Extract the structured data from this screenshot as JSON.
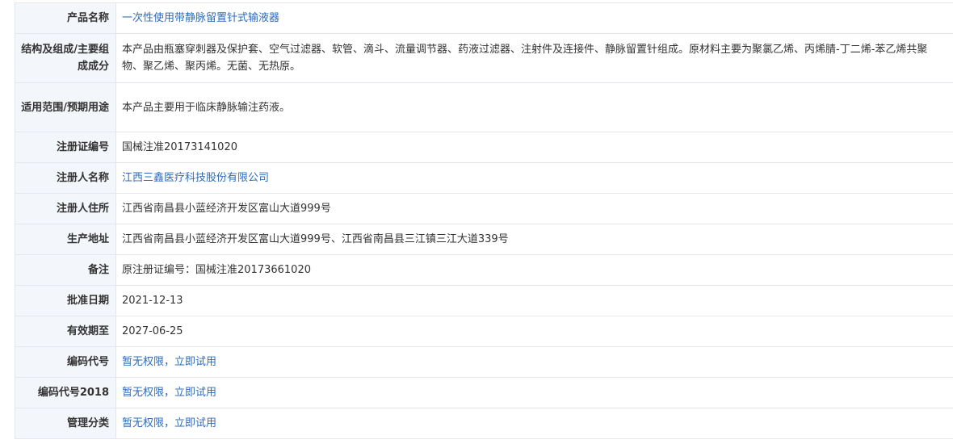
{
  "rows": [
    {
      "label": "产品名称",
      "value": "一次性使用带静脉留置针式输液器",
      "link": true
    },
    {
      "label": "结构及组成/主要组成成分",
      "value": "本产品由瓶塞穿刺器及保护套、空气过滤器、软管、滴斗、流量调节器、药液过滤器、注射件及连接件、静脉留置针组成。原材料主要为聚氯乙烯、丙烯腈-丁二烯-苯乙烯共聚物、聚乙烯、聚丙烯。无菌、无热原。",
      "link": false
    },
    {
      "label": "适用范围/预期用途",
      "value": "本产品主要用于临床静脉输注药液。",
      "link": false
    },
    {
      "label": "注册证编号",
      "value": "国械注准20173141020",
      "link": false
    },
    {
      "label": "注册人名称",
      "value": "江西三鑫医疗科技股份有限公司",
      "link": true
    },
    {
      "label": "注册人住所",
      "value": "江西省南昌县小蓝经济开发区富山大道999号",
      "link": false
    },
    {
      "label": "生产地址",
      "value": "江西省南昌县小蓝经济开发区富山大道999号、江西省南昌县三江镇三江大道339号",
      "link": false
    },
    {
      "label": "备注",
      "value": "原注册证编号：国械注准20173661020",
      "link": false
    },
    {
      "label": "批准日期",
      "value": "2021-12-13",
      "link": false
    },
    {
      "label": "有效期至",
      "value": "2027-06-25",
      "link": false
    },
    {
      "label": "编码代号",
      "value": "暂无权限，立即试用",
      "link": true
    },
    {
      "label": "编码代号2018",
      "value": "暂无权限，立即试用",
      "link": true
    },
    {
      "label": "管理分类",
      "value": "暂无权限，立即试用",
      "link": true
    }
  ],
  "colors": {
    "label_bg": "#f3f6fa",
    "border": "#e3e6ec",
    "link": "#2e6bb8",
    "text": "#333333"
  }
}
